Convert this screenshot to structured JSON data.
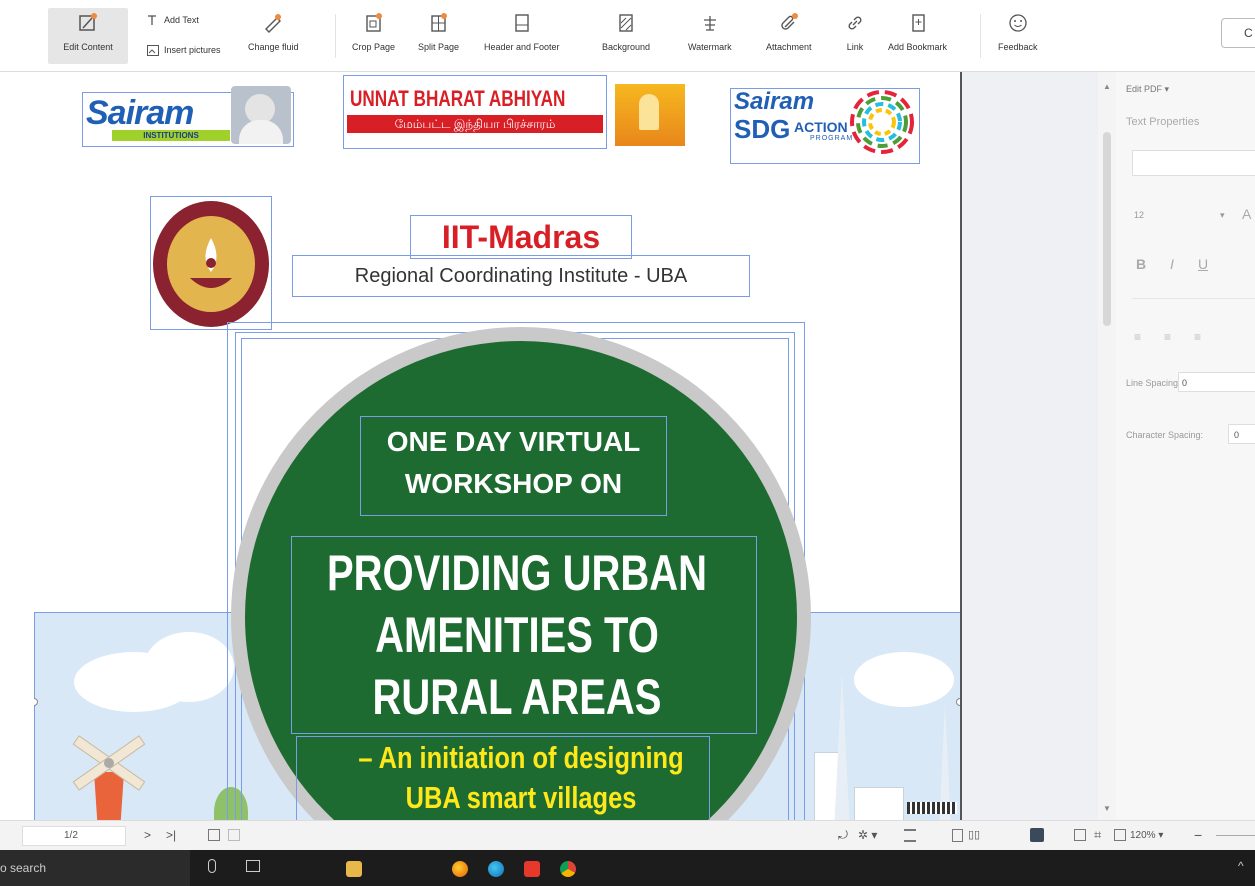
{
  "toolbar": {
    "edit_content": "Edit Content",
    "add_text": "Add Text",
    "insert_pictures": "Insert pictures",
    "change_fluid": "Change fluid",
    "crop_page": "Crop Page",
    "split_page": "Split Page",
    "header_footer": "Header and Footer",
    "background": "Background",
    "watermark": "Watermark",
    "attachment": "Attachment",
    "link": "Link",
    "add_bookmark": "Add Bookmark",
    "feedback": "Feedback",
    "right_button": "C"
  },
  "document": {
    "logo_sairam": "Sairam",
    "logo_sairam_sub": "INSTITUTIONS",
    "uba_title": "UNNAT BHARAT ABHIYAN",
    "uba_tamil": "மேம்பட்ட இந்தியா பிரச்சாரம்",
    "sdg_title": "Sairam",
    "sdg_sub": "SDG",
    "sdg_action": "ACTION",
    "sdg_program": "PROGRAM",
    "iit_title": "IIT-Madras",
    "iit_subtitle": "Regional Coordinating Institute - UBA",
    "workshop_line1": "ONE DAY VIRTUAL",
    "workshop_line2": "WORKSHOP ON",
    "main_line1": "PROVIDING URBAN",
    "main_line2": "AMENITIES TO",
    "main_line3": "RURAL AREAS",
    "yellow_line1": "– An initiation of designing",
    "yellow_line2": "UBA smart villages"
  },
  "right_panel": {
    "edit_pdf": "Edit PDF",
    "text_properties": "Text Properties",
    "font_size": "12",
    "line_spacing_label": "Line Spacing:",
    "line_spacing_value": "0",
    "char_spacing_label": "Character Spacing:",
    "char_spacing_value": "0"
  },
  "status_bar": {
    "page_indicator": "1/2",
    "zoom": "120%"
  },
  "taskbar": {
    "search_text": "o search"
  },
  "colors": {
    "circle_green": "#1e6b32",
    "uba_red": "#d81f26",
    "sairam_blue": "#1f5fb5",
    "yellow_text": "#ffe81a"
  }
}
